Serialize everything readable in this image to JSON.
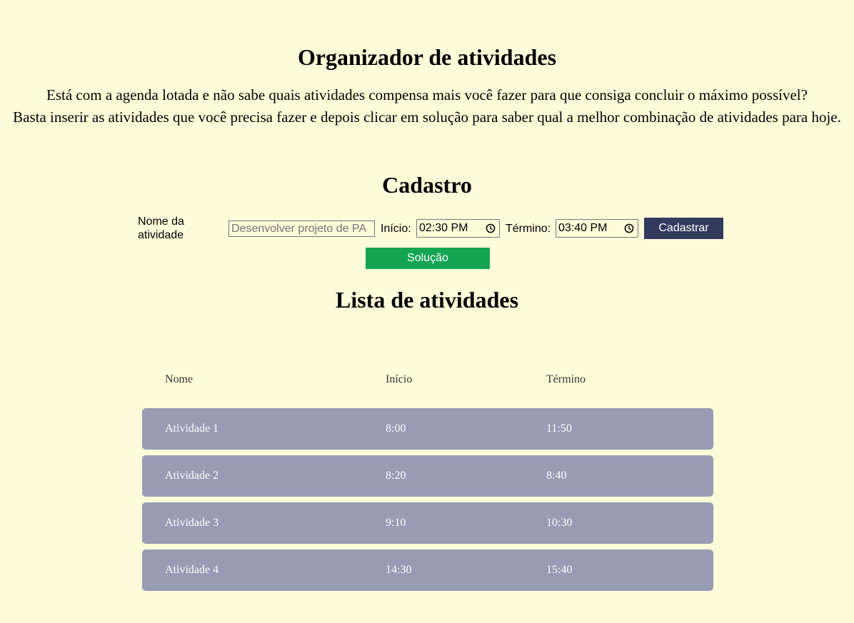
{
  "header": {
    "title": "Organizador de atividades",
    "intro_line1": "Está com a agenda lotada e não sabe quais atividades compensa mais você fazer para que consiga concluir o máximo possível?",
    "intro_line2": "Basta inserir as atividades que você precisa fazer e depois clicar em solução para saber qual a melhor combinação de atividades para hoje."
  },
  "form": {
    "title": "Cadastro",
    "name_label": "Nome da atividade",
    "name_placeholder": "Desenvolver projeto de PA",
    "start_label": "Início:",
    "start_value": "02:30 PM",
    "end_label": "Término:",
    "end_value": "03:40 PM",
    "submit_label": "Cadastrar",
    "solution_label": "Solução"
  },
  "list": {
    "title": "Lista de atividades",
    "headers": [
      "Nome",
      "Início",
      "Término"
    ],
    "rows": [
      {
        "name": "Atividade 1",
        "start": "8:00",
        "end": "11:50"
      },
      {
        "name": "Atividade 2",
        "start": "8:20",
        "end": "8:40"
      },
      {
        "name": "Atividade 3",
        "start": "9:10",
        "end": "10:30"
      },
      {
        "name": "Atividade 4",
        "start": "14:30",
        "end": "15:40"
      }
    ]
  },
  "colors": {
    "background": "#fefcd9",
    "primary_button": "#323b5e",
    "solution_button": "#14a553",
    "row_background": "#979cb4"
  },
  "icons": {
    "time_picker": "clock-icon"
  }
}
